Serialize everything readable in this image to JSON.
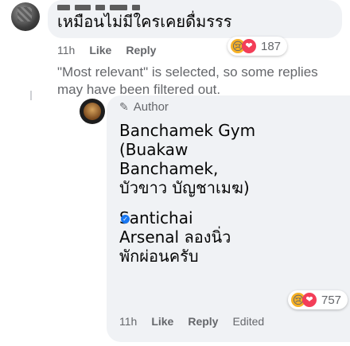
{
  "top_comment": {
    "text": "เหมือนไม่มีใครเคยดื่มรรร",
    "time": "11h",
    "like_label": "Like",
    "reply_label": "Reply",
    "reaction_count": "187"
  },
  "notice": "\"Most relevant\" is selected, so some replies may have been filtered out.",
  "reply": {
    "author_badge": "Author",
    "lines": [
      "Banchamek Gym",
      "(Buakaw",
      "Banchamek,",
      "บัวขาว บัญชาเมฆ)",
      "",
      "Santichai",
      "Arsenal ลองนิ่ว",
      "พักผ่อนครับ"
    ],
    "reaction_count": "757",
    "time": "11h",
    "like_label": "Like",
    "reply_label": "Reply",
    "edited_label": "Edited"
  },
  "colors": {
    "bubble": "#f0f2f5",
    "muted": "#65676b",
    "text": "#050505",
    "verified": "#1877f2"
  }
}
